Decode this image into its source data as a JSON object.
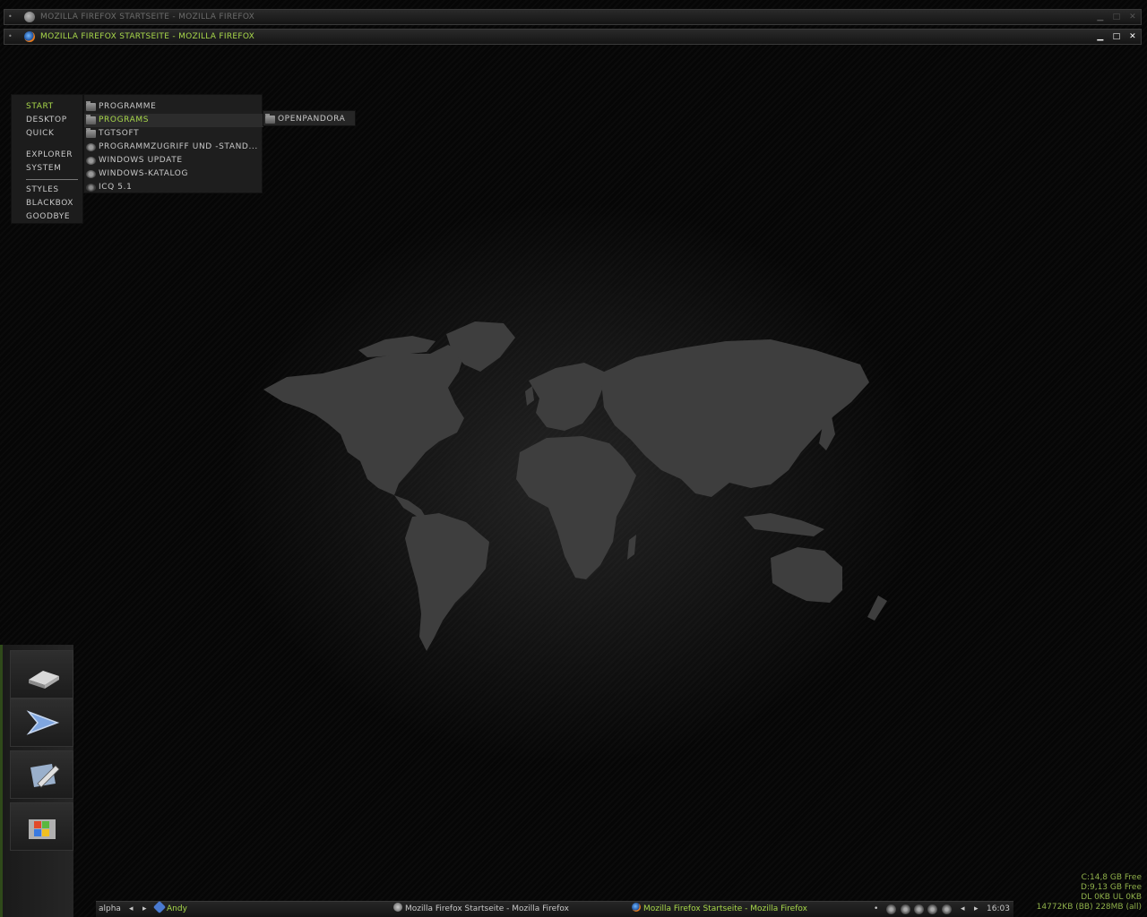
{
  "windows": [
    {
      "title": "MOZILLA FIREFOX STARTSEITE - MOZILLA FIREFOX",
      "state": "inactive"
    },
    {
      "title": "MOZILLA FIREFOX STARTSEITE - MOZILLA FIREFOX",
      "state": "active"
    }
  ],
  "window_controls": {
    "minimize": "▁",
    "maximize": "□",
    "close": "✕"
  },
  "root_menu": {
    "items": [
      "START",
      "DESKTOP",
      "QUICK",
      "EXPLORER",
      "SYSTEM",
      "STYLES",
      "BLACKBOX",
      "GOODBYE"
    ],
    "selected": "START"
  },
  "start_submenu": {
    "items": [
      {
        "label": "PROGRAMME",
        "icon": "folder-icon"
      },
      {
        "label": "PROGRAMS",
        "icon": "folder-icon",
        "highlighted": true
      },
      {
        "label": "TGTSOFT",
        "icon": "folder-icon"
      },
      {
        "label": "PROGRAMMZUGRIFF UND -STAND...",
        "icon": "gear-icon"
      },
      {
        "label": "WINDOWS UPDATE",
        "icon": "update-icon"
      },
      {
        "label": "WINDOWS-KATALOG",
        "icon": "catalog-icon"
      },
      {
        "label": "ICQ 5.1",
        "icon": "flower-icon"
      }
    ]
  },
  "programs_submenu": {
    "items": [
      {
        "label": "OPENPANDORA",
        "icon": "folder-icon"
      }
    ]
  },
  "dock": {
    "items": [
      "drive-icon",
      "arrow-icon",
      "edit-icon",
      "windows-icon"
    ]
  },
  "sysinfo": {
    "line1": "C:14,8 GB Free",
    "line2": "D:9,13 GB Free",
    "line3": "DL 0KB    UL 0KB",
    "line4": "14772KB (BB) 228MB (all)"
  },
  "taskbar": {
    "workspace": "alpha",
    "prev_arrow": "◂",
    "next_arrow": "▸",
    "user": "Andy",
    "tasks": [
      {
        "label": "Mozilla Firefox Startseite - Mozilla Firefox",
        "active": false
      },
      {
        "label": "Mozilla Firefox Startseite - Mozilla Firefox",
        "active": true
      }
    ],
    "clock": "16:03"
  },
  "colors": {
    "accent": "#a8d84a",
    "background": "#060606",
    "land": "#3e3e3e"
  }
}
